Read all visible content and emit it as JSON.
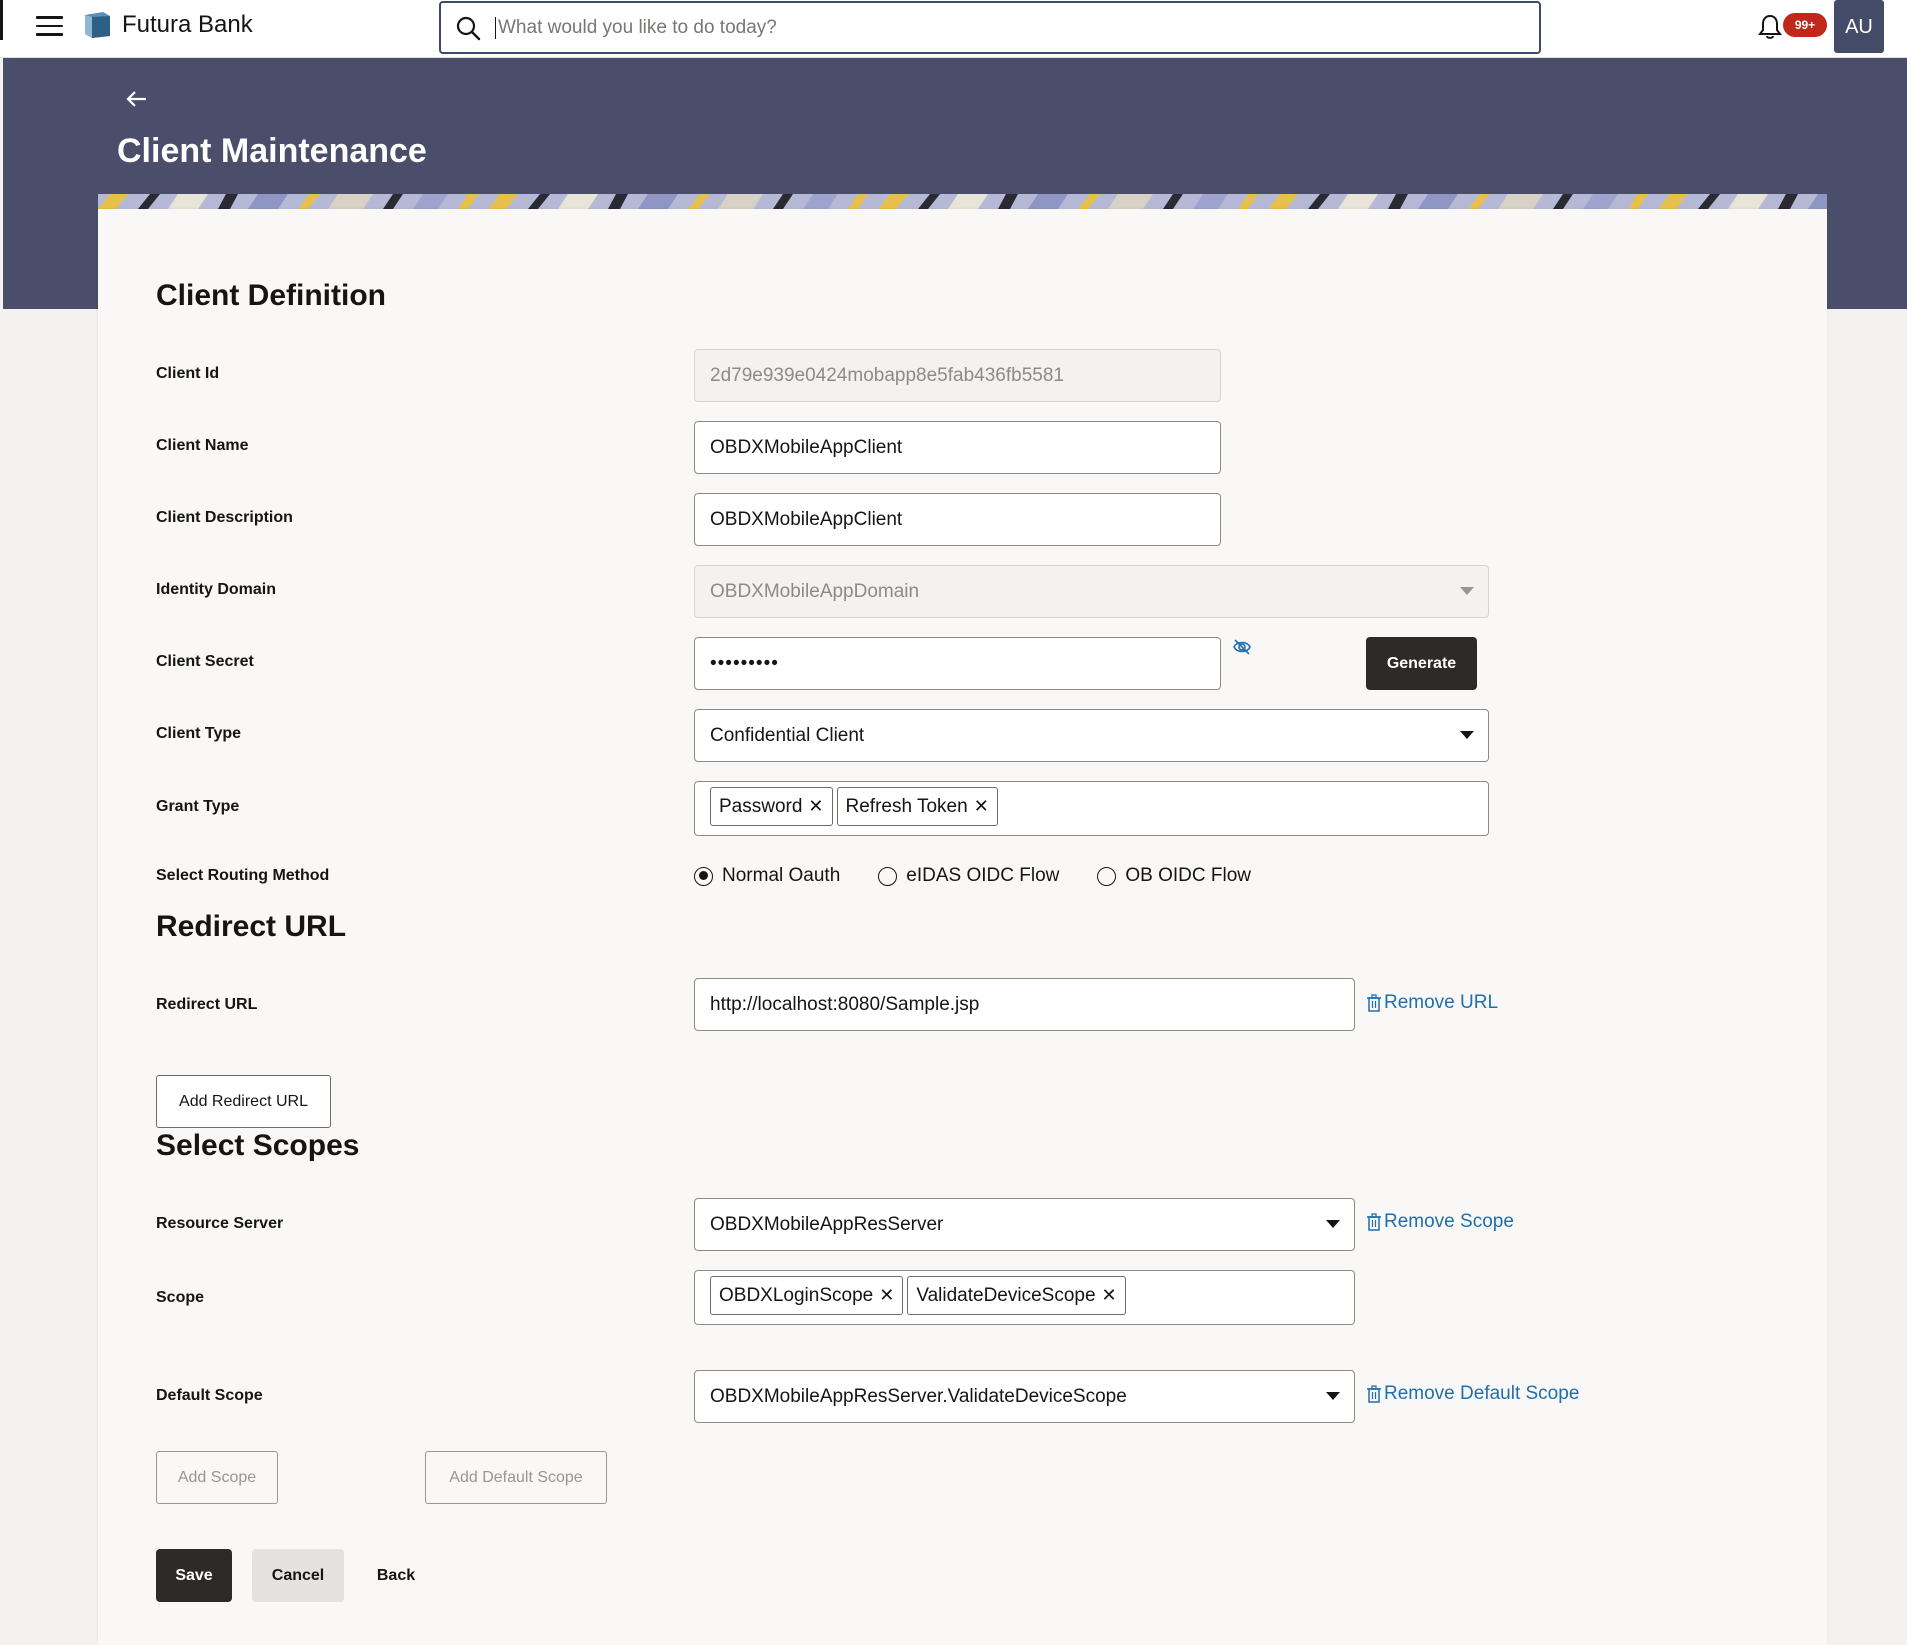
{
  "app": {
    "brand_name": "Futura Bank",
    "search_placeholder": "What would you like to do today?",
    "notification_badge": "99+",
    "user_initials": "AU"
  },
  "page": {
    "title": "Client Maintenance"
  },
  "client_definition": {
    "heading": "Client Definition",
    "client_id": {
      "label": "Client Id",
      "value": "2d79e939e0424mobapp8e5fab436fb5581"
    },
    "client_name": {
      "label": "Client Name",
      "value": "OBDXMobileAppClient"
    },
    "client_description": {
      "label": "Client Description",
      "value": "OBDXMobileAppClient"
    },
    "identity_domain": {
      "label": "Identity Domain",
      "value": "OBDXMobileAppDomain"
    },
    "client_secret": {
      "label": "Client Secret",
      "value": "•••••••••",
      "generate_label": "Generate"
    },
    "client_type": {
      "label": "Client Type",
      "value": "Confidential Client"
    },
    "grant_type": {
      "label": "Grant Type",
      "chips": [
        "Password",
        "Refresh Token"
      ]
    },
    "routing_method": {
      "label": "Select Routing Method",
      "options": [
        "Normal Oauth",
        "eIDAS OIDC Flow",
        "OB OIDC Flow"
      ],
      "selected": "Normal Oauth"
    }
  },
  "redirect": {
    "heading": "Redirect URL",
    "label": "Redirect URL",
    "value": "http://localhost:8080/Sample.jsp",
    "remove_label": "Remove URL",
    "add_label": "Add Redirect URL"
  },
  "scopes": {
    "heading": "Select Scopes",
    "resource_server": {
      "label": "Resource Server",
      "value": "OBDXMobileAppResServer",
      "remove_label": "Remove Scope"
    },
    "scope": {
      "label": "Scope",
      "chips": [
        "OBDXLoginScope",
        "ValidateDeviceScope"
      ]
    },
    "default_scope": {
      "label": "Default Scope",
      "value": "OBDXMobileAppResServer.ValidateDeviceScope",
      "remove_label": "Remove Default Scope"
    },
    "add_scope_label": "Add Scope",
    "add_default_scope_label": "Add Default Scope"
  },
  "actions": {
    "save": "Save",
    "cancel": "Cancel",
    "back": "Back"
  },
  "colors": {
    "header_band": "#4a4e6a",
    "primary_button": "#2d2a27",
    "link": "#1f6fae",
    "badge": "#c0281c"
  }
}
